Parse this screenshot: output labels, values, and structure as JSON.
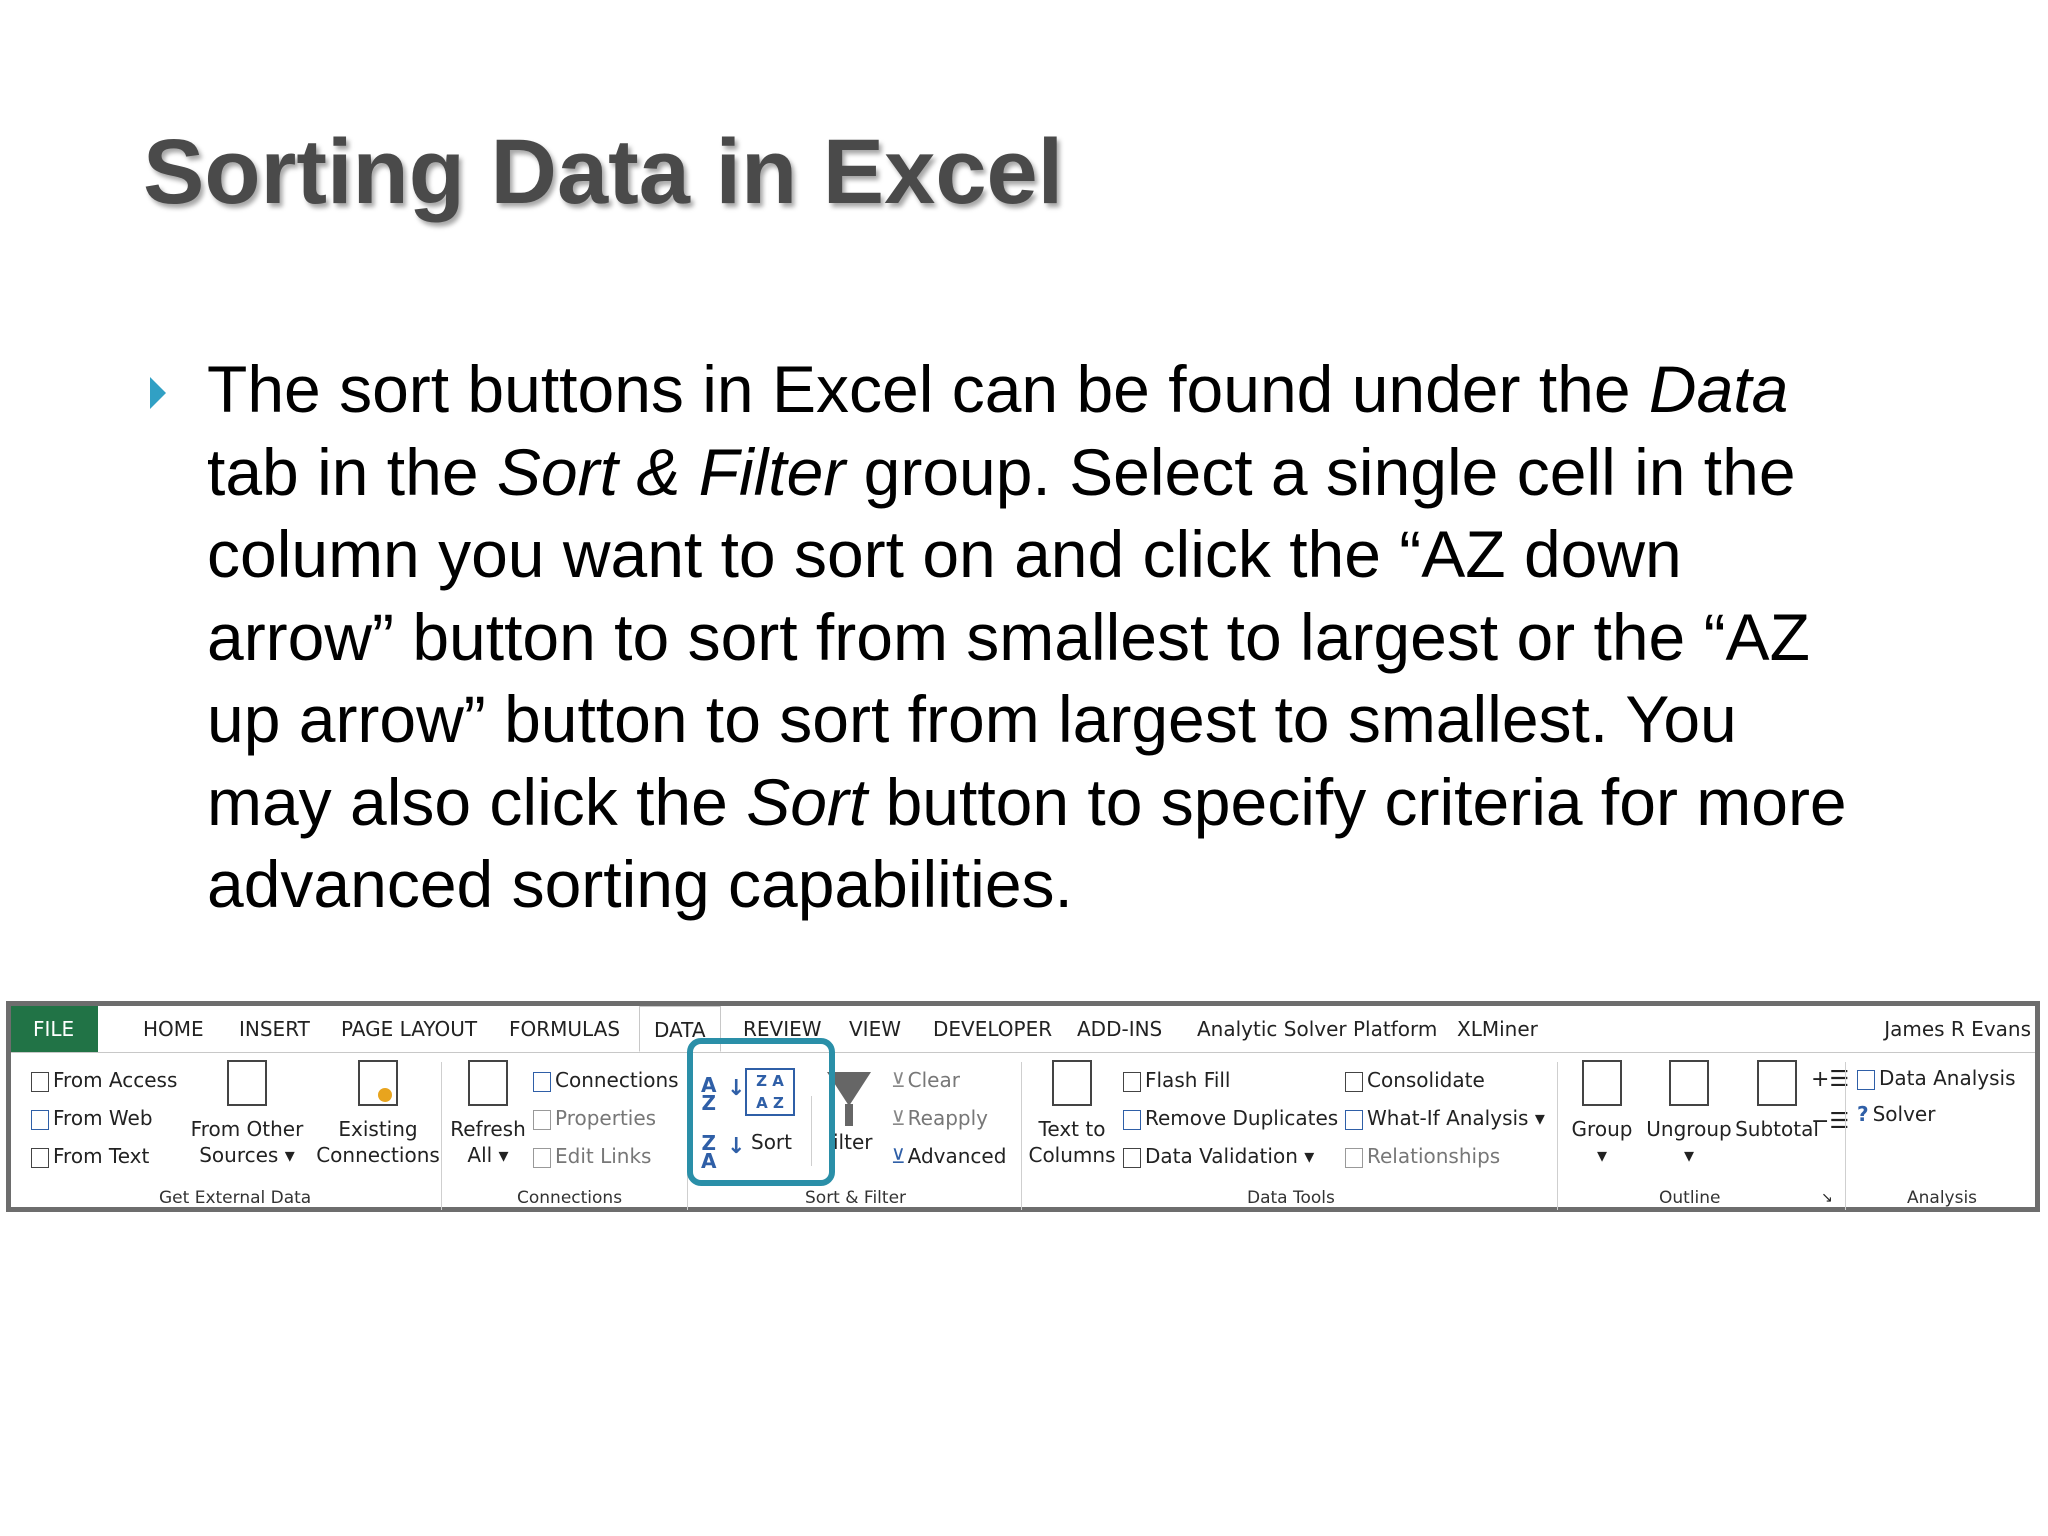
{
  "slide": {
    "title": "Sorting Data in Excel",
    "body_segments": [
      {
        "line": [
          "The sort buttons in Excel can be found under the ",
          {
            "i": "Data"
          }
        ]
      },
      {
        "line": [
          "tab in the ",
          {
            "i": "Sort & Filter"
          },
          " group. Select a single cell in the"
        ]
      },
      {
        "line": [
          "column you want to sort on and click the “AZ down"
        ]
      },
      {
        "line": [
          "arrow” button to sort from smallest to largest or the “AZ"
        ]
      },
      {
        "line": [
          "up arrow” button to sort from largest to smallest. You"
        ]
      },
      {
        "line": [
          "may also click the ",
          {
            "i": "Sort"
          },
          " button to specify criteria for more"
        ]
      },
      {
        "line": [
          "advanced sorting capabilities."
        ]
      }
    ]
  },
  "ribbon": {
    "tabs": [
      "FILE",
      "HOME",
      "INSERT",
      "PAGE LAYOUT",
      "FORMULAS",
      "DATA",
      "REVIEW",
      "VIEW",
      "DEVELOPER",
      "ADD-INS",
      "Analytic Solver Platform",
      "XLMiner"
    ],
    "active_tab": "DATA",
    "user": "James R Evans",
    "get_external_data": {
      "from_access": "From Access",
      "from_web": "From Web",
      "from_text": "From Text",
      "from_other_1": "From Other",
      "from_other_2": "Sources ▾",
      "existing_1": "Existing",
      "existing_2": "Connections",
      "label": "Get External Data"
    },
    "connections": {
      "refresh_1": "Refresh",
      "refresh_2": "All ▾",
      "connections": "Connections",
      "properties": "Properties",
      "edit_links": "Edit Links",
      "label": "Connections"
    },
    "sort_filter": {
      "sort_az_top": "A",
      "sort_az_bottom": "Z",
      "sort_za_top": "Z",
      "sort_za_bottom": "A",
      "sort_box_top": "Z A",
      "sort_box_bottom": "A Z",
      "sort": "Sort",
      "filter": "ilter",
      "clear": "Clear",
      "reapply": "Reapply",
      "advanced": "Advanced",
      "label": "Sort & Filter"
    },
    "data_tools": {
      "text_to_1": "Text to",
      "text_to_2": "Columns",
      "flash_fill": "Flash Fill",
      "remove_duplicates": "Remove Duplicates",
      "data_validation": "Data Validation ▾",
      "consolidate": "Consolidate",
      "what_if": "What-If Analysis ▾",
      "relationships": "Relationships",
      "label": "Data Tools"
    },
    "outline": {
      "group": "Group",
      "ungroup": "Ungroup",
      "subtotal": "Subtotal",
      "label": "Outline"
    },
    "analysis": {
      "data_analysis": "Data Analysis",
      "solver": "Solver",
      "label": "Analysis"
    },
    "colors": {
      "file_tab": "#217346",
      "highlight": "#2a8fa8",
      "bullet": "#31a0c4"
    }
  }
}
